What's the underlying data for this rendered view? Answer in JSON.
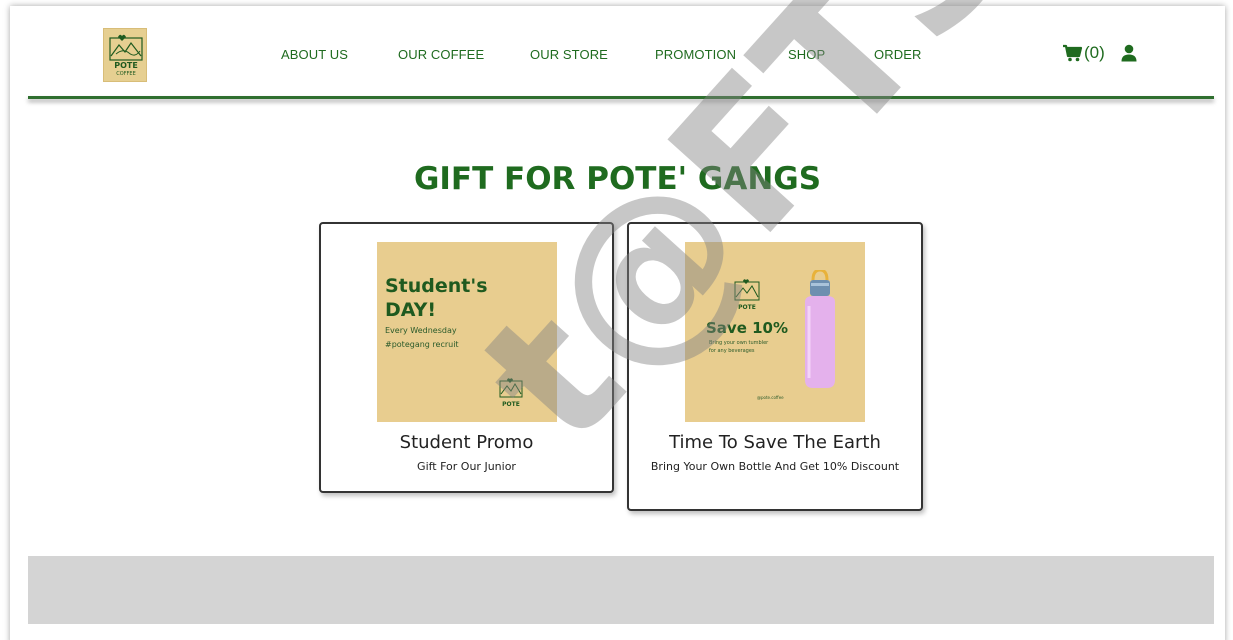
{
  "brand": {
    "logo_text": "POTE",
    "logo_subtext": "COFFEE",
    "color_primary": "#1f6b1f",
    "color_logo_bg": "#e6cf91"
  },
  "nav": {
    "items": [
      {
        "label": "ABOUT US"
      },
      {
        "label": "OUR COFFEE"
      },
      {
        "label": "OUR STORE"
      },
      {
        "label": "PROMOTION"
      },
      {
        "label": "SHOP"
      },
      {
        "label": "ORDER"
      }
    ],
    "cart_icon": "cart-icon",
    "cart_count": "(0)",
    "user_icon": "user-icon"
  },
  "main": {
    "section_title": "GIFT FOR POTE' GANGS",
    "cards": [
      {
        "image": {
          "heading_line1": "Student's",
          "heading_line2": "DAY!",
          "line1": "Every Wednesday",
          "line2": "#potegang recruit",
          "logo_text": "POTE",
          "bg_color": "#e8cd8f"
        },
        "title": "Student Promo",
        "subtitle": "Gift For Our Junior"
      },
      {
        "image": {
          "heading": "Save 10%",
          "line1": "Bring your own tumbler",
          "line2": "for any beverages",
          "handle": "@pote.coffee",
          "logo_text": "POTE",
          "bottle_color": "#e6b6ee",
          "bg_color": "#e8cd8f"
        },
        "title": "Time To Save The Earth",
        "subtitle": "Bring Your Own Bottle And Get 10% Discount"
      }
    ]
  },
  "watermark": "t@FTSM"
}
